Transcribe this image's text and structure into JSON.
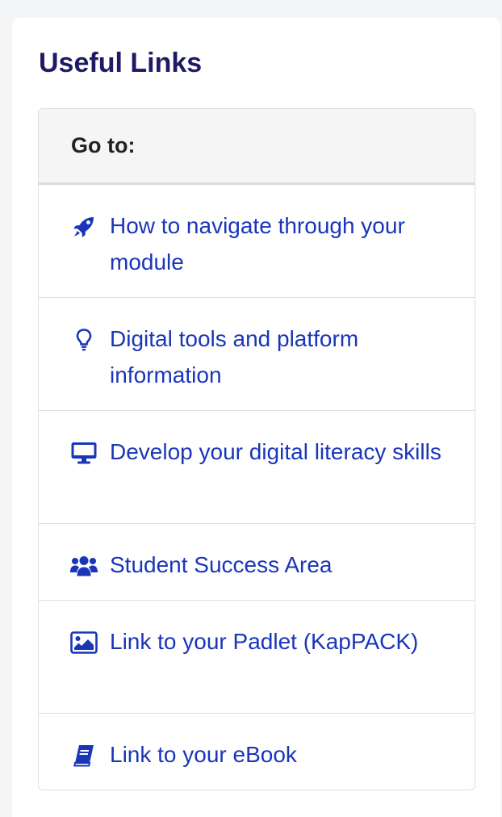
{
  "card": {
    "title": "Useful Links"
  },
  "links_box": {
    "header": "Go to:",
    "items": [
      {
        "icon": "rocket-icon",
        "label": "How to navigate through your module"
      },
      {
        "icon": "lightbulb-icon",
        "label": "Digital tools and platform information"
      },
      {
        "icon": "desktop-icon",
        "label": "Develop your digital literacy skills"
      },
      {
        "icon": "users-icon",
        "label": "Student Success Area"
      },
      {
        "icon": "image-icon",
        "label": "Link to your Padlet (KapPACK)"
      },
      {
        "icon": "book-icon",
        "label": "Link to your eBook"
      }
    ]
  },
  "colors": {
    "title": "#1e1a63",
    "link": "#1a36b8",
    "header_bg": "#f5f5f5"
  }
}
